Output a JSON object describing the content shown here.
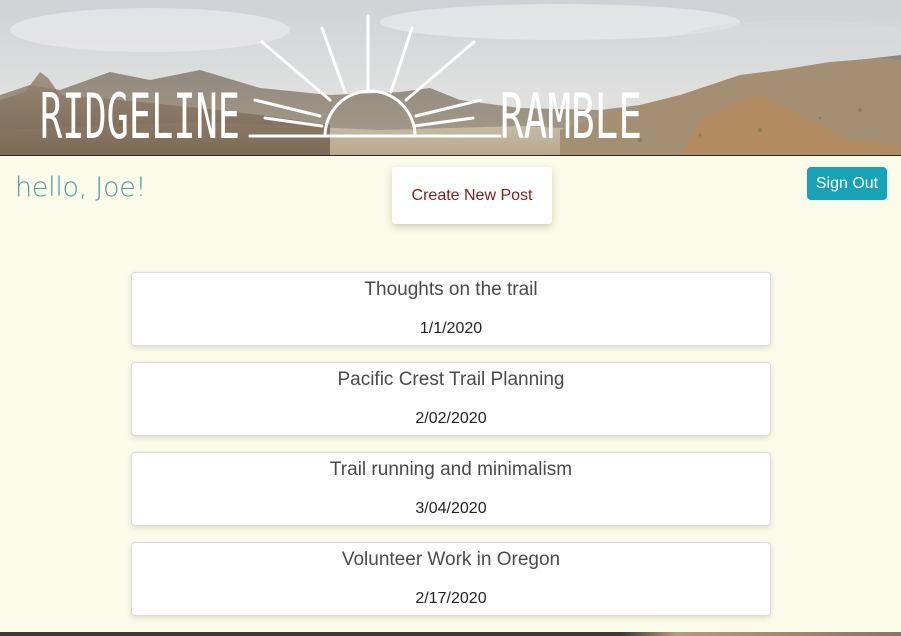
{
  "header": {
    "title_left": "RIDGELINE",
    "title_right": "RAMBLE"
  },
  "greeting": "hello, Joe!",
  "buttons": {
    "create_post": "Create New Post",
    "sign_out": "Sign Out"
  },
  "posts": [
    {
      "title": "Thoughts on the trail",
      "date": "1/1/2020"
    },
    {
      "title": "Pacific Crest Trail Planning",
      "date": "2/02/2020"
    },
    {
      "title": "Trail running and minimalism",
      "date": "3/04/2020"
    },
    {
      "title": "Volunteer Work in Oregon",
      "date": "2/17/2020"
    }
  ],
  "colors": {
    "page_background": "#fbfbe9",
    "greeting_text": "#4e9a9e",
    "create_button_text": "#7a1f1f",
    "signout_button_bg": "#17a2b8"
  }
}
